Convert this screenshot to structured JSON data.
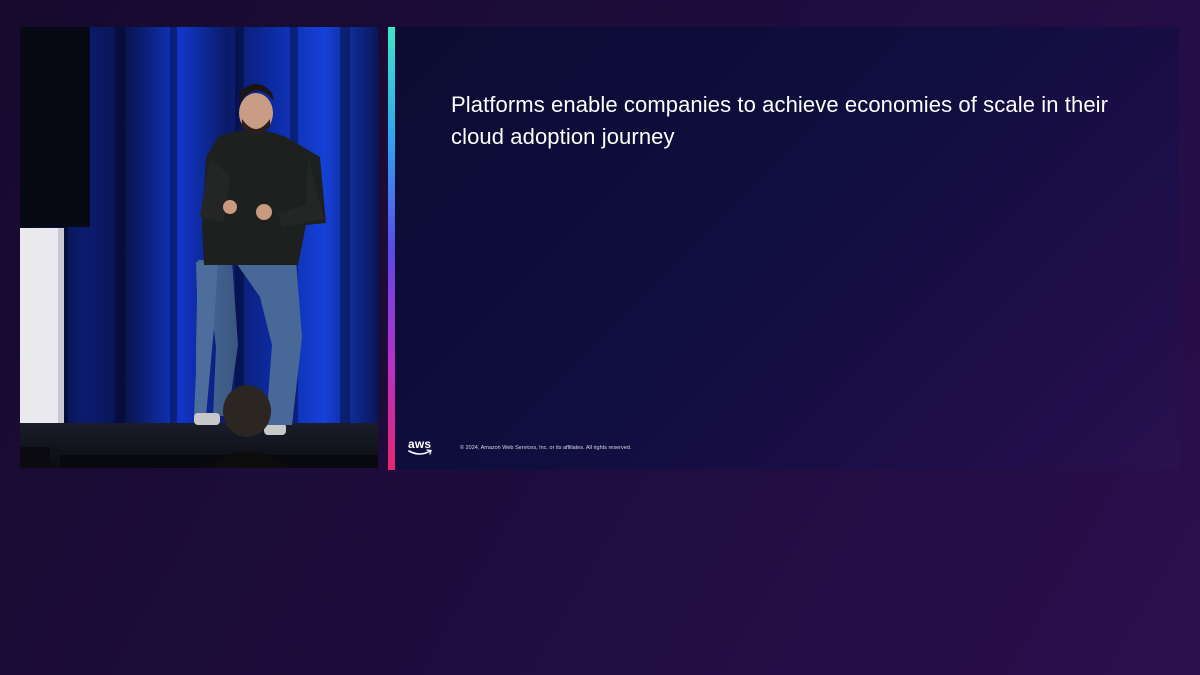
{
  "slide": {
    "title": "Platforms enable companies to achieve economies of scale in their cloud adoption journey",
    "logo_text": "aws",
    "copyright": "© 2024, Amazon Web Services, Inc. or its affiliates. All rights reserved."
  },
  "video": {
    "description_icon": "speaker-video-icon"
  },
  "colors": {
    "background": "#1e0c3c",
    "slide_background": "#0f0e3e",
    "accent_top": "#3ee6c8",
    "accent_bottom": "#e8266f",
    "text": "#ffffff"
  }
}
